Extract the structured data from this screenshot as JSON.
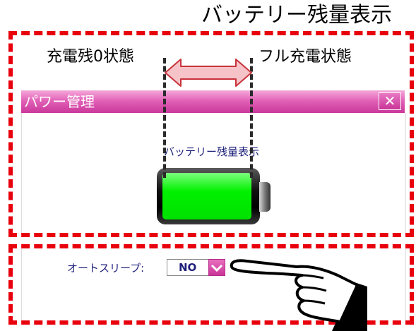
{
  "annotation": {
    "heading": "バッテリー残量表示",
    "label_empty": "充電残0状態",
    "label_full": "フル充電状態"
  },
  "window": {
    "title": "パワー管理",
    "close_glyph": "✕",
    "battery_caption": "バッテリー残量表示",
    "battery_level": 1.0,
    "auto_sleep": {
      "label": "オートスリープ:",
      "value": "NO"
    }
  },
  "colors": {
    "annotation_border": "#e8000d",
    "title_bar": "#d94aab",
    "battery_fill": "#00ee00",
    "label_text": "#1e1f7a"
  },
  "icons": [
    "close-icon",
    "chevron-down-icon",
    "battery-icon",
    "double-arrow-icon",
    "pointing-hand-icon"
  ]
}
